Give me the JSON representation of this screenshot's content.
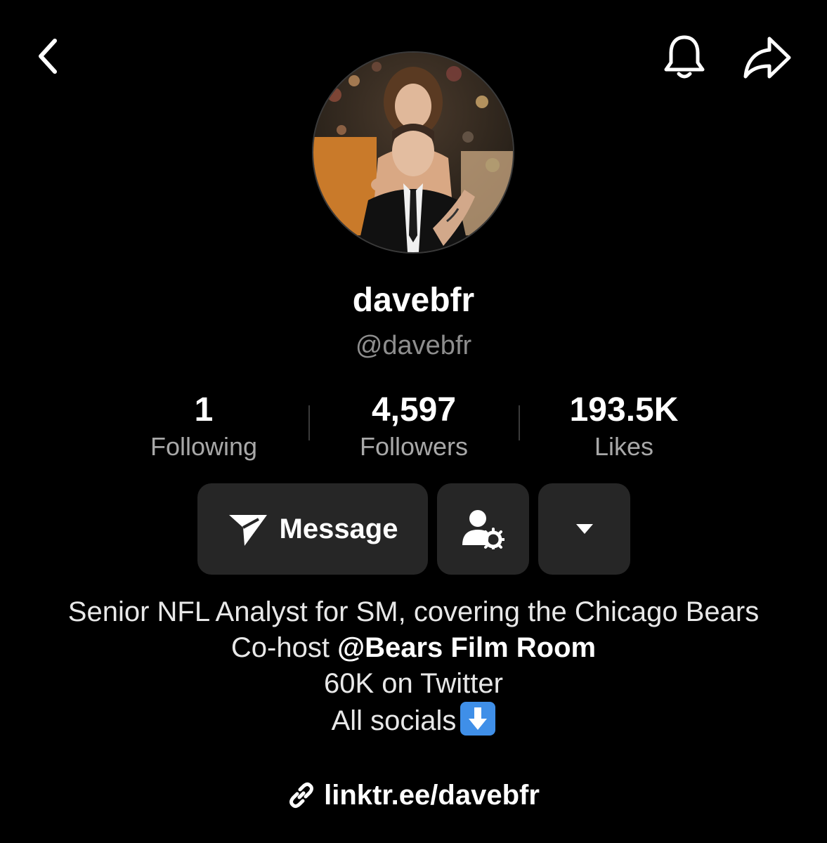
{
  "header": {
    "back_icon": "chevron-left-icon",
    "bell_icon": "bell-icon",
    "share_icon": "share-arrow-icon"
  },
  "profile": {
    "display_name": "davebfr",
    "handle": "@davebfr"
  },
  "stats": [
    {
      "value": "1",
      "label": "Following"
    },
    {
      "value": "4,597",
      "label": "Followers"
    },
    {
      "value": "193.5K",
      "label": "Likes"
    }
  ],
  "actions": {
    "message_label": "Message",
    "message_icon": "send-icon",
    "friend_icon": "user-settings-icon",
    "more_icon": "caret-down-icon"
  },
  "bio": {
    "line1": "Senior NFL Analyst for SM, covering the Chicago Bears",
    "line2_prefix": "Co-host ",
    "line2_mention": "@Bears Film Room",
    "line3": "60K on Twitter",
    "line4": "All socials",
    "line4_emoji_icon": "down-arrow-emoji-icon"
  },
  "link": {
    "text": "linktr.ee/davebfr",
    "icon": "link-icon"
  },
  "colors": {
    "background": "#000000",
    "button_bg": "#262626",
    "secondary_text": "#8e8e8e",
    "emoji_blue": "#3f8fe8"
  }
}
